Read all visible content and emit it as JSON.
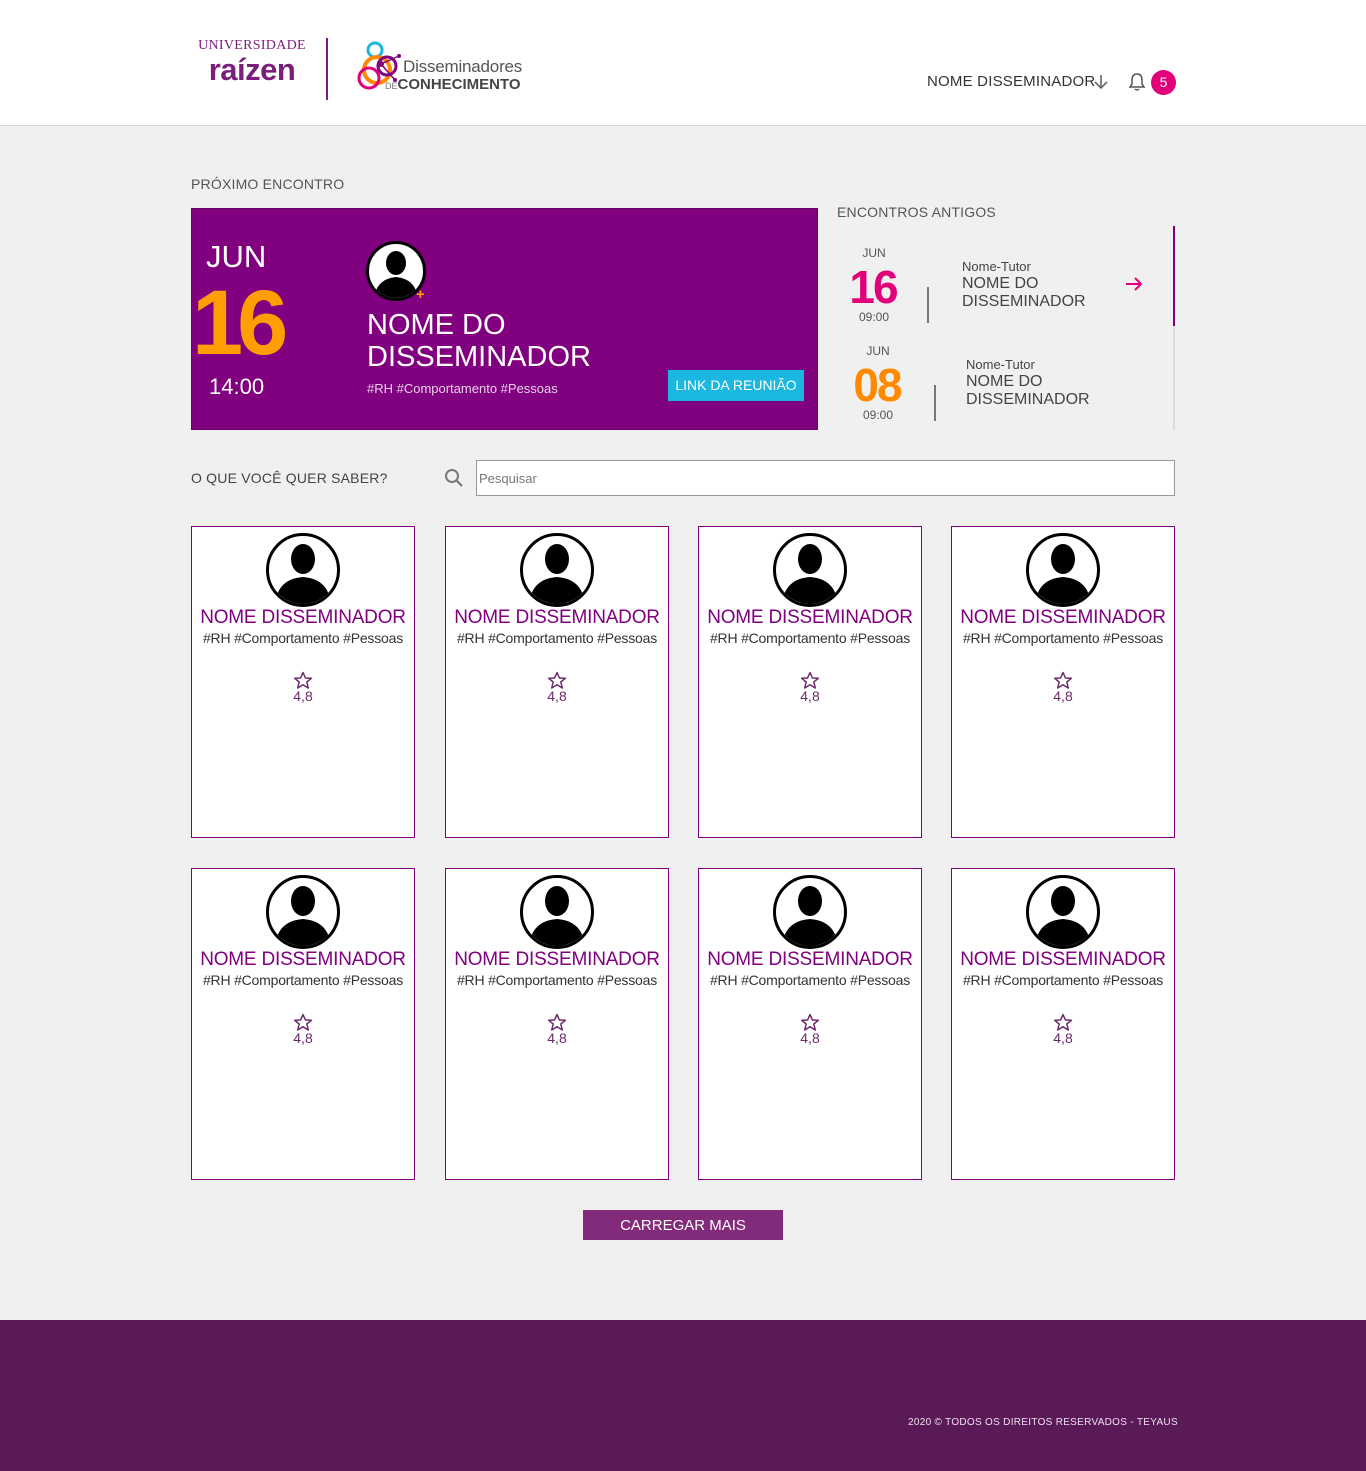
{
  "header": {
    "logo_universidade": "UNIVERSIDADE",
    "logo_raizen": "raízen",
    "logo_disseminadores": "Disseminadores",
    "logo_de": "DE",
    "logo_conhecimento": "CONHECIMENTO",
    "user_name": "NOME DISSEMINADOR",
    "notification_count": "5"
  },
  "next_meeting": {
    "section_title": "PRÓXIMO ENCONTRO",
    "month": "JUN",
    "day": "16",
    "time": "14:00",
    "name_line1": "NOME DO",
    "name_line2": "DISSEMINADOR",
    "tags": "#RH #Comportamento #Pessoas",
    "link_label": "LINK DA REUNIÃO"
  },
  "old_meetings": {
    "section_title": "ENCONTROS ANTIGOS",
    "items": [
      {
        "month": "JUN",
        "day": "16",
        "time": "09:00",
        "tutor": "Nome-Tutor",
        "name_line1": "NOME DO",
        "name_line2": "DISSEMINADOR",
        "day_color": "#e2007a"
      },
      {
        "month": "JUN",
        "day": "08",
        "time": "09:00",
        "tutor": "Nome-Tutor",
        "name_line1": "NOME DO",
        "name_line2": "DISSEMINADOR",
        "day_color": "#ff8a00"
      }
    ]
  },
  "search": {
    "label": "O QUE VOCÊ QUER SABER?",
    "placeholder": "Pesquisar"
  },
  "cards": [
    {
      "name": "NOME DISSEMINADOR",
      "tags": "#RH #Comportamento #Pessoas",
      "rating": "4,8"
    },
    {
      "name": "NOME DISSEMINADOR",
      "tags": "#RH #Comportamento #Pessoas",
      "rating": "4,8"
    },
    {
      "name": "NOME DISSEMINADOR",
      "tags": "#RH #Comportamento #Pessoas",
      "rating": "4,8"
    },
    {
      "name": "NOME DISSEMINADOR",
      "tags": "#RH #Comportamento #Pessoas",
      "rating": "4,8"
    },
    {
      "name": "NOME DISSEMINADOR",
      "tags": "#RH #Comportamento #Pessoas",
      "rating": "4,8"
    },
    {
      "name": "NOME DISSEMINADOR",
      "tags": "#RH #Comportamento #Pessoas",
      "rating": "4,8"
    },
    {
      "name": "NOME DISSEMINADOR",
      "tags": "#RH #Comportamento #Pessoas",
      "rating": "4,8"
    },
    {
      "name": "NOME DISSEMINADOR",
      "tags": "#RH #Comportamento #Pessoas",
      "rating": "4,8"
    }
  ],
  "load_more_label": "CARREGAR MAIS",
  "footer": {
    "copyright": "2020 © TODOS OS DIREITOS RESERVADOS - TEYAUS"
  },
  "colors": {
    "brand_purple": "#800080",
    "accent_orange": "#ff9e00",
    "accent_pink": "#e2007a",
    "link_cyan": "#1ab7e0",
    "footer_purple": "#5a1a57"
  },
  "icons": [
    "avatar-icon",
    "arrow-down-icon",
    "bell-icon",
    "arrow-right-icon",
    "search-icon",
    "star-icon"
  ]
}
